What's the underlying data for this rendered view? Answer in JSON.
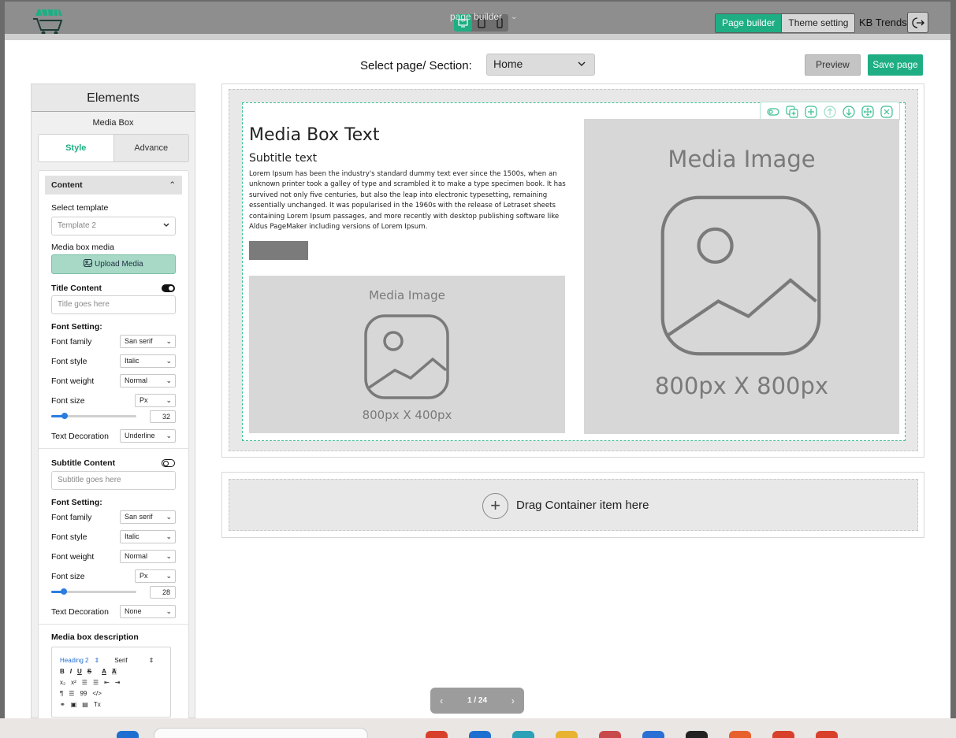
{
  "topbar": {
    "title": "page builder",
    "toggle": {
      "page_builder": "Page builder",
      "theme_setting": "Theme setting"
    },
    "brand": "KB Trends",
    "accent": "#1fae83"
  },
  "toolbar": {
    "select_label": "Select page/ Section:",
    "selected_page": "Home",
    "preview": "Preview",
    "save": "Save page"
  },
  "elements_panel": {
    "title": "Elements",
    "subtitle": "Media Box",
    "tabs": {
      "style": "Style",
      "advance": "Advance"
    },
    "content_header": "Content",
    "select_template_label": "Select template",
    "template_value": "Template 2",
    "media_label": "Media box media",
    "upload_label": "Upload Media",
    "title_content": {
      "label": "Title Content",
      "placeholder": "Title goes here",
      "font_setting": "Font Setting:",
      "font_family_label": "Font family",
      "font_family": "San serif",
      "font_style_label": "Font style",
      "font_style": "Italic",
      "font_weight_label": "Font weight",
      "font_weight": "Normal",
      "font_size_label": "Font size",
      "font_unit": "Px",
      "font_size": "32",
      "font_size_fraction": 0.16,
      "decoration_label": "Text Decoration",
      "decoration": "Underline"
    },
    "subtitle_content": {
      "label": "Subtitle Content",
      "placeholder": "Subtitle goes here",
      "font_setting": "Font Setting:",
      "font_family_label": "Font family",
      "font_family": "San serif",
      "font_style_label": "Font style",
      "font_style": "Italic",
      "font_weight_label": "Font weight",
      "font_weight": "Normal",
      "font_size_label": "Font size",
      "font_unit": "Px",
      "font_size": "28",
      "font_size_fraction": 0.15,
      "decoration_label": "Text Decoration",
      "decoration": "None"
    },
    "description_label": "Media box description",
    "rte": {
      "heading": "Heading 2",
      "font": "Serif",
      "row1": [
        "B",
        "I",
        "U",
        "S",
        "A",
        "A"
      ],
      "row2": [
        "x₂",
        "x²",
        "☰",
        "☰",
        "⇤",
        "⇥"
      ],
      "row3": [
        "¶",
        "☰",
        "99",
        "</>"
      ],
      "row4": [
        "🔗",
        "▣",
        "▤",
        "Tx"
      ]
    }
  },
  "canvas": {
    "media_box_title": "Media Box Text",
    "media_box_subtitle": "Subtitle text",
    "media_box_text": "Lorem Ipsum has been the industry's standard dummy text ever since the 1500s, when an unknown printer took a galley of type and scrambled it to make a type specimen book. It has survived not only five centuries, but also the leap into electronic typesetting, remaining essentially unchanged. It was popularised in the 1960s with the release of Letraset sheets containing Lorem Ipsum passages, and more recently with desktop publishing software like Aldus PageMaker including versions of Lorem Ipsum.",
    "small_image": {
      "label": "Media Image",
      "size": "800px X 400px"
    },
    "large_image": {
      "label": "Media Image",
      "size": "800px X 800px"
    },
    "drag_text": "Drag Container item here",
    "tool_icons": [
      "eye-toggle-icon",
      "duplicate-icon",
      "add-icon",
      "move-up-icon",
      "move-down-icon",
      "move-icon",
      "close-icon"
    ]
  },
  "pager": {
    "label": "1 / 24"
  }
}
